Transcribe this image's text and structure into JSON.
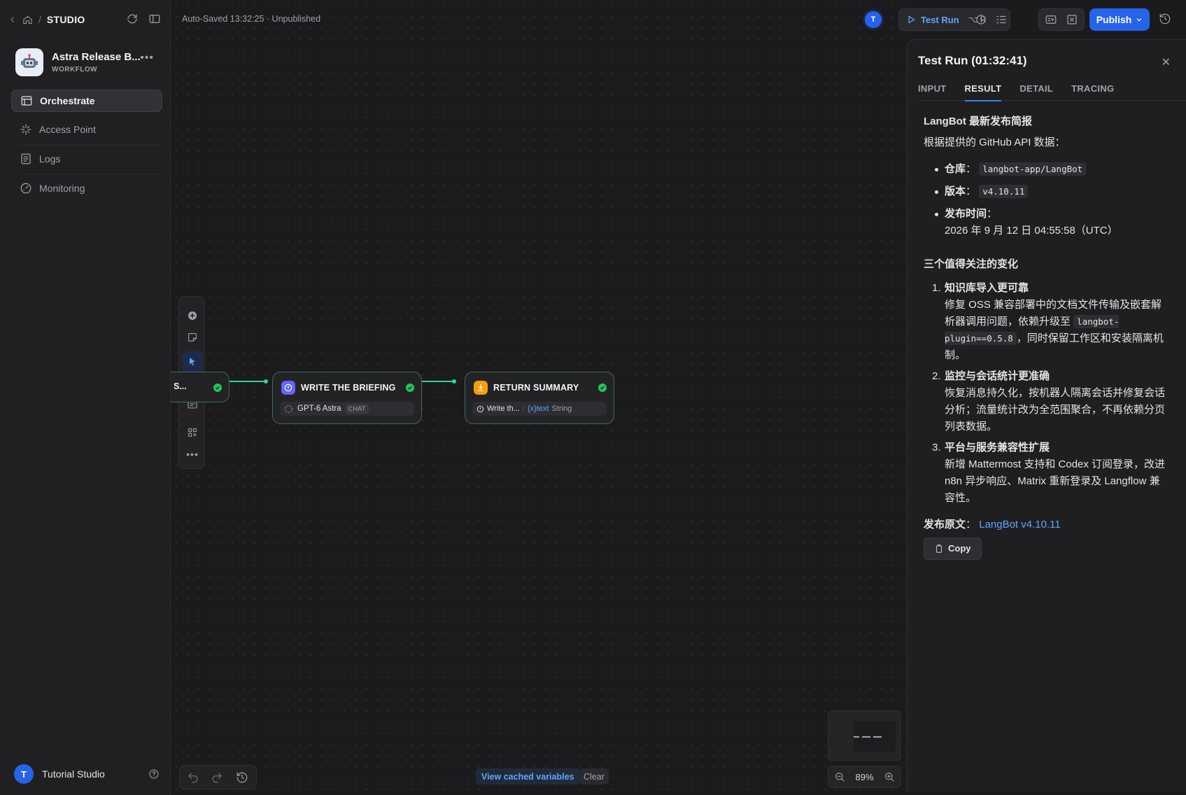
{
  "nav_header": {
    "studio_label": "STUDIO"
  },
  "app": {
    "name": "Astra Release B...",
    "type": "WORKFLOW"
  },
  "sidebar": {
    "items": [
      {
        "label": "Orchestrate"
      },
      {
        "label": "Access Point"
      },
      {
        "label": "Logs"
      },
      {
        "label": "Monitoring"
      }
    ]
  },
  "user": {
    "initial": "T",
    "name": "Tutorial Studio"
  },
  "status": {
    "autosave": "Auto-Saved 13:32:25 · Unpublished"
  },
  "toolbar": {
    "collab_initial": "T",
    "test_run_label": "Test Run",
    "test_run_shortcut": "⌥ R",
    "publish_label": "Publish"
  },
  "nodes": [
    {
      "title": "S...",
      "icon": "start-icon"
    },
    {
      "title": "WRITE THE BRIEFING",
      "model": "GPT-6 Astra",
      "model_tag": "CHAT",
      "icon": "llm-icon",
      "color": "#6366f1"
    },
    {
      "title": "RETURN SUMMARY",
      "var_source": "Write th...",
      "var_name": "{x}text",
      "var_type": "String",
      "icon": "end-icon",
      "color": "#f59e0b"
    }
  ],
  "canvas_footer": {
    "cached_vars_label": "View cached variables",
    "clear_label": "Clear",
    "zoom": "89%"
  },
  "panel": {
    "title": "Test Run (01:32:41)",
    "tabs": [
      "INPUT",
      "RESULT",
      "DETAIL",
      "TRACING"
    ],
    "active_tab": "RESULT",
    "result": {
      "heading": "LangBot 最新发布简报",
      "intro": "根据提供的 GitHub API 数据：",
      "bullets": [
        {
          "label": "仓库",
          "sep": "：",
          "code": "langbot-app/LangBot"
        },
        {
          "label": "版本",
          "sep": "：",
          "code": "v4.10.11"
        },
        {
          "label": "发布时间",
          "sep": "：",
          "text": "2026 年 9 月 12 日 04:55:58（UTC）"
        }
      ],
      "changes_heading": "三个值得关注的变化",
      "changes": [
        {
          "num": "1.",
          "title": "知识库导入更可靠",
          "text_before": "修复 OSS 兼容部署中的文档文件传输及嵌套解析器调用问题，依赖升级至 ",
          "code": "langbot-plugin==0.5.8",
          "text_after": "，同时保留工作区和安装隔离机制。"
        },
        {
          "num": "2.",
          "title": "监控与会话统计更准确",
          "text_before": "恢复消息持久化，按机器人隔离会话并修复会话分析；流量统计改为全范围聚合，不再依赖分页列表数据。",
          "code": "",
          "text_after": ""
        },
        {
          "num": "3.",
          "title": "平台与服务兼容性扩展",
          "text_before": "新增 Mattermost 支持和 Codex 订阅登录，改进 n8n 异步响应、Matrix 重新登录及 Langflow 兼容性。",
          "code": "",
          "text_after": ""
        }
      ],
      "source_label": "发布原文",
      "source_sep": "：",
      "source_link": "LangBot v4.10.11",
      "copy_label": "Copy"
    }
  },
  "colors": {
    "accent": "#2563eb",
    "success": "#22c55e",
    "edge": "#2dd4a0",
    "link": "#60a5fa"
  }
}
